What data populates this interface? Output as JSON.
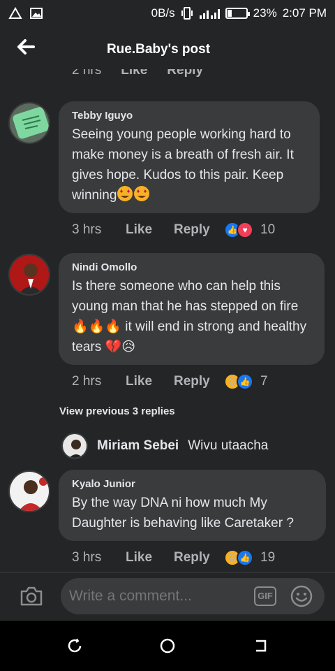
{
  "status_bar": {
    "net_speed": "0B/s",
    "battery": "23%",
    "time": "2:07 PM",
    "battery_level": 0.23
  },
  "header": {
    "title": "Rue.Baby's post",
    "back_icon": "arrow-left-icon"
  },
  "top_meta": {
    "time": "2 hrs",
    "like": "Like",
    "reply": "Reply"
  },
  "comments": [
    {
      "author": "Tebby Iguyo",
      "text": "Seeing young people working hard to make money is a breath of fresh air. It gives hope. Kudos to this pair. Keep winning",
      "time": "3 hrs",
      "like": "Like",
      "reply": "Reply",
      "reactions": [
        "like",
        "love"
      ],
      "reaction_count": "10"
    },
    {
      "author": "Nindi Omollo",
      "text_a": "Is there someone who can help this young man that he has stepped on fire",
      "text_b": "it will end in strong and healthy tears",
      "time": "2 hrs",
      "like": "Like",
      "reply": "Reply",
      "reactions": [
        "haha",
        "like"
      ],
      "reaction_count": "7"
    },
    {
      "author": "Kyalo Junior",
      "text": "By the way DNA ni how much My Daughter is behaving like Caretaker ?",
      "time": "3 hrs",
      "like": "Like",
      "reply": "Reply",
      "reactions": [
        "haha",
        "like"
      ],
      "reaction_count": "19"
    }
  ],
  "view_replies": "View previous 3 replies",
  "reply_preview": {
    "author": "Miriam Sebei",
    "text": "Wivu utaacha"
  },
  "composer": {
    "placeholder": "Write a comment...",
    "gif_label": "GIF"
  },
  "colors": {
    "background": "#242526",
    "bubble": "#3a3b3c",
    "like_blue": "#1877f2",
    "love_red": "#f33e58",
    "haha_yellow": "#f7b125"
  }
}
